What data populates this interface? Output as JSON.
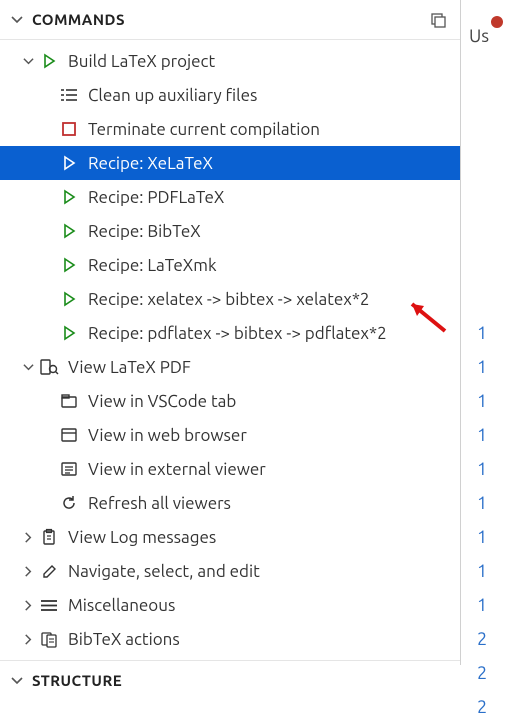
{
  "section_commands": "COMMANDS",
  "section_structure": "STRUCTURE",
  "tree": {
    "build": {
      "label": "Build LaTeX project",
      "clean": "Clean up auxiliary files",
      "terminate": "Terminate current compilation",
      "r_xelatex": "Recipe: XeLaTeX",
      "r_pdflatex": "Recipe: PDFLaTeX",
      "r_bibtex": "Recipe: BibTeX",
      "r_latexmk": "Recipe: LaTeXmk",
      "r_xelatex_chain": "Recipe: xelatex -> bibtex -> xelatex*2",
      "r_pdflatex_chain": "Recipe: pdflatex -> bibtex -> pdflatex*2"
    },
    "view": {
      "label": "View LaTeX PDF",
      "tab": "View in VSCode tab",
      "browser": "View in web browser",
      "external": "View in external viewer",
      "refresh": "Refresh all viewers"
    },
    "log": "View Log messages",
    "nav": "Navigate, select, and edit",
    "misc": "Miscellaneous",
    "bibtex": "BibTeX actions"
  },
  "right_strip": {
    "us_text": "Us",
    "line_numbers": [
      "1",
      "1",
      "1",
      "1",
      "1",
      "1",
      "1",
      "1",
      "1",
      "2",
      "2",
      "2"
    ]
  }
}
